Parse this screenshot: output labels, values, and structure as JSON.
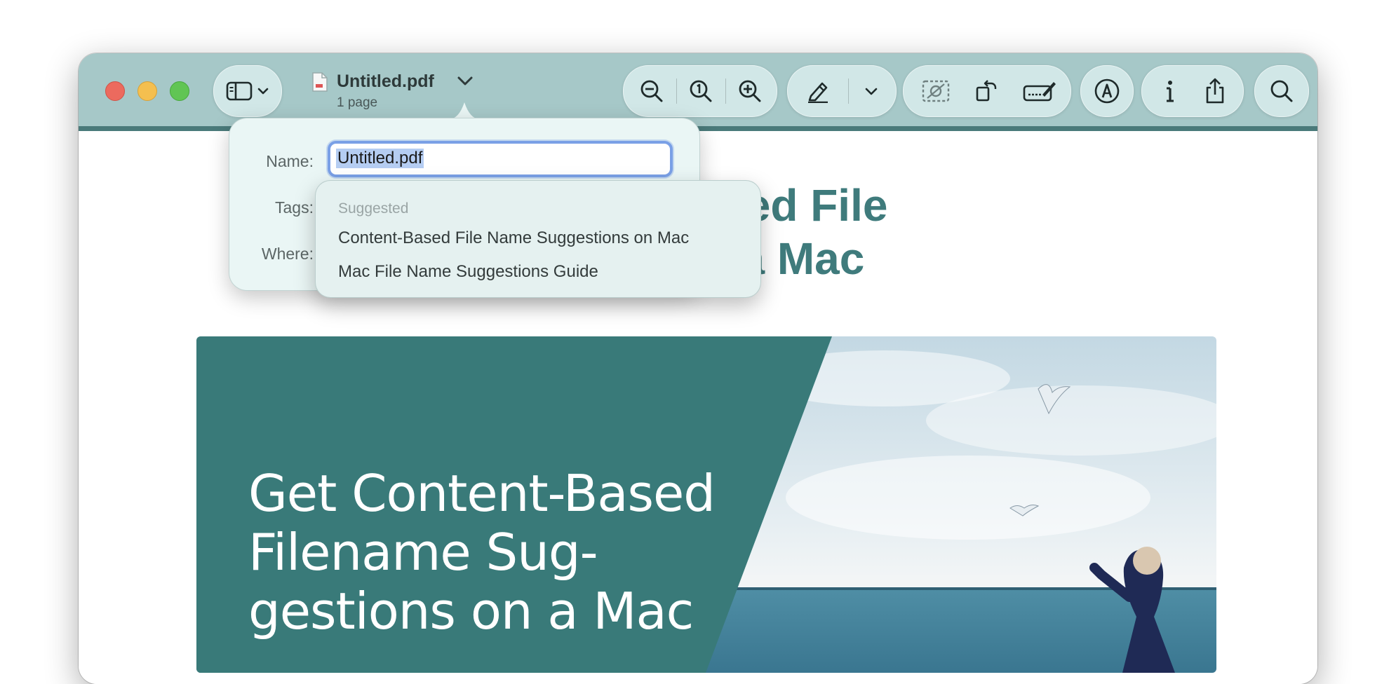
{
  "window": {
    "document_title": "Untitled.pdf",
    "document_subtitle": "1 page"
  },
  "toolbar": {
    "icons": [
      "sidebar-icon",
      "chevron-down-icon",
      "zoom-out-icon",
      "actual-size-icon",
      "zoom-in-icon",
      "highlight-pen-icon",
      "chevron-down-icon",
      "image-description-icon",
      "rotate-icon",
      "markup-icon",
      "accessibility-icon",
      "info-icon",
      "share-icon",
      "search-icon"
    ]
  },
  "save_popover": {
    "name_label": "Name:",
    "name_value": "Untitled.pdf",
    "tags_label": "Tags:",
    "where_label": "Where:"
  },
  "suggestions": {
    "header": "Suggested",
    "items": [
      "Content-Based File Name Suggestions on Mac",
      "Mac File Name Suggestions Guide"
    ]
  },
  "document": {
    "heading_line1": "ent-Based File",
    "heading_line2": "ns on a Mac",
    "hero_line1": "Get Content-Based",
    "hero_line2": "Filename Sug-",
    "hero_line3": "gestions on a Mac"
  },
  "colors": {
    "toolbar": "#a6c8c8",
    "accent_teal": "#3f7b7c",
    "hero_teal": "#397a79"
  }
}
